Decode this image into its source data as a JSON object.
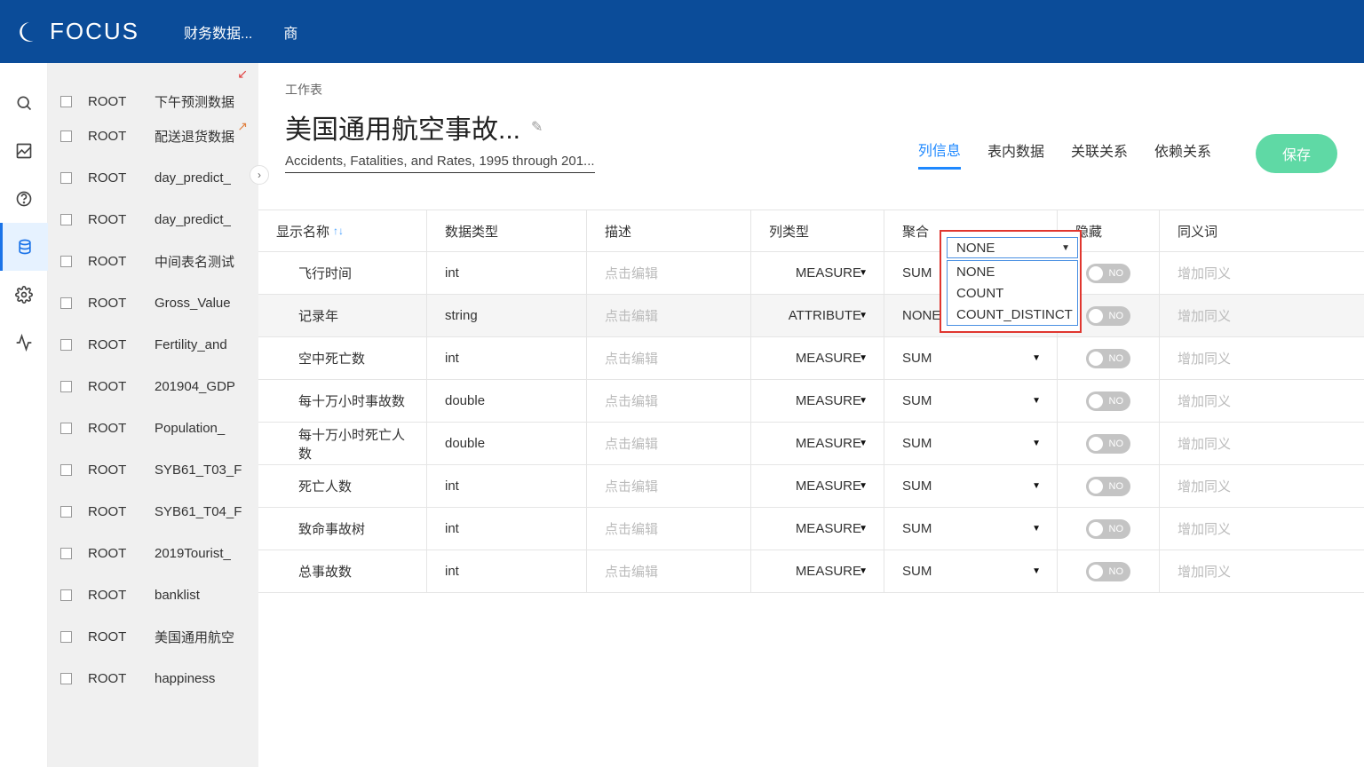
{
  "topbar": {
    "brand": "FOCUS",
    "menu1": "财务数据...",
    "menu2": "商"
  },
  "sidepanel": {
    "items": [
      {
        "owner": "ROOT",
        "name": "下午预测数据",
        "link": "in"
      },
      {
        "owner": "ROOT",
        "name": "配送退货数据",
        "link": "out"
      },
      {
        "owner": "ROOT",
        "name": "day_predict_"
      },
      {
        "owner": "ROOT",
        "name": "day_predict_"
      },
      {
        "owner": "ROOT",
        "name": "中间表名测试"
      },
      {
        "owner": "ROOT",
        "name": "Gross_Value"
      },
      {
        "owner": "ROOT",
        "name": "Fertility_and"
      },
      {
        "owner": "ROOT",
        "name": "201904_GDP"
      },
      {
        "owner": "ROOT",
        "name": "Population_"
      },
      {
        "owner": "ROOT",
        "name": "SYB61_T03_F"
      },
      {
        "owner": "ROOT",
        "name": "SYB61_T04_F"
      },
      {
        "owner": "ROOT",
        "name": "2019Tourist_"
      },
      {
        "owner": "ROOT",
        "name": "banklist"
      },
      {
        "owner": "ROOT",
        "name": "美国通用航空"
      },
      {
        "owner": "ROOT",
        "name": "happiness"
      }
    ]
  },
  "main": {
    "breadcrumb": "工作表",
    "title": "美国通用航空事故...",
    "subtitle": "Accidents, Fatalities, and Rates, 1995 through 201...",
    "tabs": [
      "列信息",
      "表内数据",
      "关联关系",
      "依赖关系"
    ],
    "save": "保存"
  },
  "grid": {
    "headers": {
      "c1": "显示名称",
      "c2": "数据类型",
      "c3": "描述",
      "c4": "列类型",
      "c5": "聚合",
      "c6": "隐藏",
      "c7": "同义词"
    },
    "desc_placeholder": "点击编辑",
    "syno_placeholder": "增加同义",
    "toggle_off": "NO",
    "rows": [
      {
        "name": "飞行时间",
        "dtype": "int",
        "ctype": "MEASURE",
        "agg": "SUM"
      },
      {
        "name": "记录年",
        "dtype": "string",
        "ctype": "ATTRIBUTE",
        "agg": "NONE",
        "selected": true
      },
      {
        "name": "空中死亡数",
        "dtype": "int",
        "ctype": "MEASURE",
        "agg": "SUM"
      },
      {
        "name": "每十万小时事故数",
        "dtype": "double",
        "ctype": "MEASURE",
        "agg": "SUM"
      },
      {
        "name": "每十万小时死亡人数",
        "dtype": "double",
        "ctype": "MEASURE",
        "agg": "SUM"
      },
      {
        "name": "死亡人数",
        "dtype": "int",
        "ctype": "MEASURE",
        "agg": "SUM"
      },
      {
        "name": "致命事故树",
        "dtype": "int",
        "ctype": "MEASURE",
        "agg": "SUM"
      },
      {
        "name": "总事故数",
        "dtype": "int",
        "ctype": "MEASURE",
        "agg": "SUM"
      }
    ]
  },
  "dropdown": {
    "selected": "NONE",
    "options": [
      "NONE",
      "COUNT",
      "COUNT_DISTINCT"
    ]
  }
}
